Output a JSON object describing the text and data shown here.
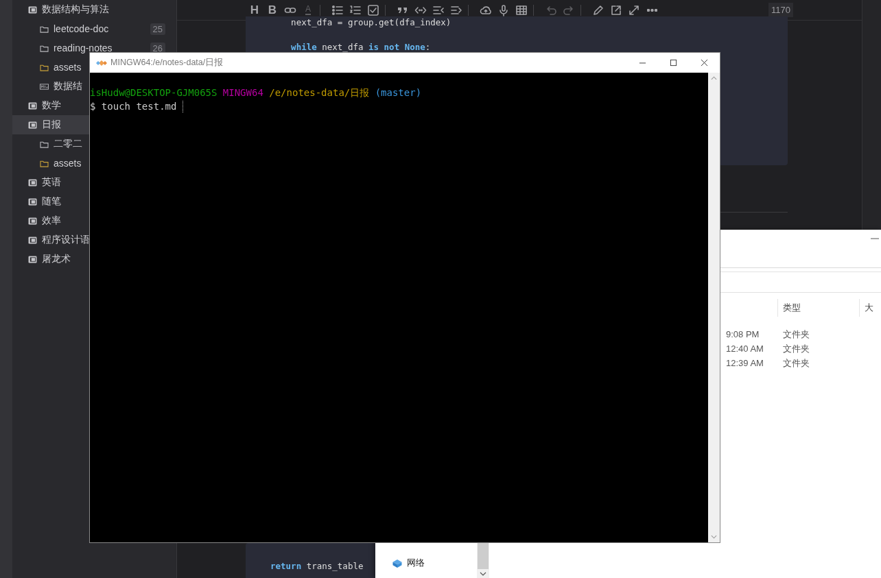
{
  "editor": {
    "sidebar": {
      "items": [
        {
          "label": "数据结构与算法",
          "kind": "notebook",
          "selected": false,
          "children": [
            {
              "label": "leetcode-doc",
              "kind": "folder",
              "count": "25",
              "selected": false
            },
            {
              "label": "reading-notes",
              "kind": "folder",
              "count": "26",
              "selected": false
            },
            {
              "label": "assets",
              "kind": "assets",
              "selected": false
            },
            {
              "label": "数据结",
              "kind": "markdown",
              "selected": false
            }
          ]
        },
        {
          "label": "数学",
          "kind": "notebook",
          "selected": false
        },
        {
          "label": "日报",
          "kind": "notebook",
          "selected": true,
          "children": [
            {
              "label": "二零二",
              "kind": "folder",
              "selected": false
            },
            {
              "label": "assets",
              "kind": "assets",
              "selected": false
            }
          ]
        },
        {
          "label": "英语",
          "kind": "notebook",
          "selected": false
        },
        {
          "label": "随笔",
          "kind": "notebook",
          "selected": false
        },
        {
          "label": "效率",
          "kind": "notebook",
          "selected": false
        },
        {
          "label": "程序设计语",
          "kind": "notebook",
          "selected": false
        },
        {
          "label": "屠龙术",
          "kind": "notebook",
          "selected": false
        }
      ]
    },
    "toolbar": {
      "groups": [
        [
          {
            "kind": "heading",
            "label": "H",
            "disabled": false
          },
          {
            "kind": "bold",
            "label": "B",
            "disabled": false
          },
          {
            "kind": "link",
            "disabled": false
          },
          {
            "kind": "text-color",
            "label": "A",
            "disabled": true
          }
        ],
        [
          {
            "kind": "bullet-list",
            "disabled": false
          },
          {
            "kind": "ordered-list",
            "disabled": false
          },
          {
            "kind": "task",
            "disabled": false
          }
        ],
        [
          {
            "kind": "quote",
            "disabled": false
          },
          {
            "kind": "code",
            "disabled": false
          },
          {
            "kind": "indent",
            "disabled": false
          },
          {
            "kind": "outdent",
            "disabled": false
          }
        ],
        [
          {
            "kind": "upload",
            "disabled": false
          },
          {
            "kind": "mic",
            "disabled": false
          },
          {
            "kind": "table",
            "disabled": false
          }
        ],
        [
          {
            "kind": "undo",
            "disabled": true
          },
          {
            "kind": "redo",
            "disabled": true
          }
        ],
        [
          {
            "kind": "edit",
            "disabled": false
          },
          {
            "kind": "open-external",
            "disabled": false
          },
          {
            "kind": "fullscreen",
            "disabled": false
          },
          {
            "kind": "more",
            "disabled": false
          }
        ]
      ],
      "word_count": "1170"
    },
    "code_blocks": [
      {
        "lines": [
          {
            "tokens": [
              {
                "text": "    next_dfa = group.get(dfa_index)",
                "kind": "plain"
              }
            ]
          },
          {
            "tokens": [
              {
                "text": "    while",
                "kind": "keyword"
              },
              {
                "text": " next_dfa ",
                "kind": "plain"
              },
              {
                "text": "is not None",
                "kind": "keyword"
              },
              {
                "text": ":",
                "kind": "plain"
              }
            ]
          }
        ]
      },
      {
        "lines": [
          {
            "tokens": [
              {
                "text": "return",
                "kind": "keyword"
              },
              {
                "text": " trans_table",
                "kind": "plain"
              }
            ]
          }
        ]
      }
    ]
  },
  "explorer": {
    "columns": [
      {
        "label": "类型"
      },
      {
        "label": "大"
      }
    ],
    "rows": [
      {
        "column_1": "9:08 PM",
        "type": "文件夹"
      },
      {
        "column_1": "12:40 AM",
        "type": "文件夹"
      },
      {
        "column_1": "12:39 AM",
        "type": "文件夹"
      }
    ],
    "nav_items": [
      {
        "label": "网络",
        "kind": "network"
      }
    ]
  },
  "terminal": {
    "title": "MINGW64:/e/notes-data/日报",
    "lines": [
      {
        "segments": [
          {
            "text": "isHudw@DESKTOP-GJM065S",
            "color": "#13a10e"
          },
          {
            "text": "MINGW64",
            "color": "#b4009e"
          },
          {
            "text": "/e/notes-data/日报",
            "color": "#c19c00"
          },
          {
            "text": "(master)",
            "color": "#3a96dd"
          }
        ]
      },
      {
        "cursor": true,
        "segments": [
          {
            "text": "$ touch test.md",
            "color": "#cccccc"
          }
        ]
      }
    ]
  }
}
